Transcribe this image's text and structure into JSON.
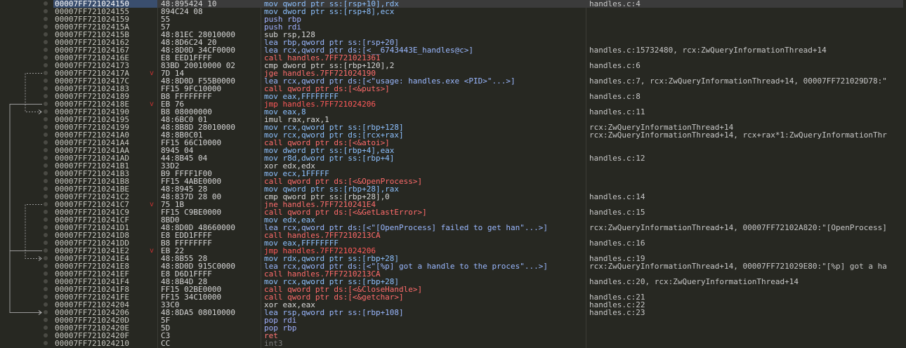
{
  "disasm": {
    "rows": [
      {
        "addr": "00007FF721024150",
        "bytes": "48:895424 10",
        "instr": "mov qword ptr ss:[rsp+10],rdx",
        "kind": "mov",
        "mark": "",
        "comment": "handles.c:4",
        "selected": true
      },
      {
        "addr": "00007FF721024155",
        "bytes": "894C24 08",
        "instr": "mov dword ptr ss:[rsp+8],ecx",
        "kind": "mov",
        "mark": "",
        "comment": ""
      },
      {
        "addr": "00007FF721024159",
        "bytes": "55",
        "instr": "push rbp",
        "kind": "push",
        "mark": "",
        "comment": ""
      },
      {
        "addr": "00007FF72102415A",
        "bytes": "57",
        "instr": "push rdi",
        "kind": "push",
        "mark": "",
        "comment": ""
      },
      {
        "addr": "00007FF72102415B",
        "bytes": "48:81EC 28010000",
        "instr": "sub rsp,128",
        "kind": "other",
        "mark": "",
        "comment": ""
      },
      {
        "addr": "00007FF721024162",
        "bytes": "48:8D6C24 20",
        "instr": "lea rbp,qword ptr ss:[rsp+20]",
        "kind": "lea",
        "mark": "",
        "comment": ""
      },
      {
        "addr": "00007FF721024167",
        "bytes": "48:8D0D 34CF0000",
        "instr": "lea rcx,qword ptr ds:[<__6743443E_handles@c>]",
        "kind": "lea",
        "mark": "",
        "comment": "handles.c:15732480, rcx:ZwQueryInformationThread+14"
      },
      {
        "addr": "00007FF72102416E",
        "bytes": "E8 EED1FFFF",
        "instr": "call handles.7FF721021361",
        "kind": "call",
        "mark": "",
        "comment": ""
      },
      {
        "addr": "00007FF721024173",
        "bytes": "83BD 20010000 02",
        "instr": "cmp dword ptr ss:[rbp+120],2",
        "kind": "other",
        "mark": "",
        "comment": "handles.c:6"
      },
      {
        "addr": "00007FF72102417A",
        "bytes": "7D 14",
        "instr": "jge handles.7FF721024190",
        "kind": "jcc",
        "mark": "v",
        "comment": ""
      },
      {
        "addr": "00007FF72102417C",
        "bytes": "48:8D0D F55B0000",
        "instr": "lea rcx,qword ptr ds:[<\"usage: handles.exe <PID>\"...>]",
        "kind": "lea",
        "mark": "",
        "comment": "handles.c:7, rcx:ZwQueryInformationThread+14, 00007FF721029D78:\""
      },
      {
        "addr": "00007FF721024183",
        "bytes": "FF15 9FC10000",
        "instr": "call qword ptr ds:[<&puts>]",
        "kind": "call",
        "mark": "",
        "comment": ""
      },
      {
        "addr": "00007FF721024189",
        "bytes": "B8 FFFFFFFF",
        "instr": "mov eax,FFFFFFFF",
        "kind": "mov",
        "mark": "",
        "comment": "handles.c:8"
      },
      {
        "addr": "00007FF72102418E",
        "bytes": "EB 76",
        "instr": "jmp handles.7FF721024206",
        "kind": "jmp",
        "mark": "v",
        "comment": ""
      },
      {
        "addr": "00007FF721024190",
        "bytes": "B8 08000000",
        "instr": "mov eax,8",
        "kind": "mov",
        "mark": "",
        "comment": "handles.c:11"
      },
      {
        "addr": "00007FF721024195",
        "bytes": "48:6BC0 01",
        "instr": "imul rax,rax,1",
        "kind": "other",
        "mark": "",
        "comment": ""
      },
      {
        "addr": "00007FF721024199",
        "bytes": "48:8B8D 28010000",
        "instr": "mov rcx,qword ptr ss:[rbp+128]",
        "kind": "mov",
        "mark": "",
        "comment": "rcx:ZwQueryInformationThread+14"
      },
      {
        "addr": "00007FF7210241A0",
        "bytes": "48:8B0C01",
        "instr": "mov rcx,qword ptr ds:[rcx+rax]",
        "kind": "mov",
        "mark": "",
        "comment": "rcx:ZwQueryInformationThread+14, rcx+rax*1:ZwQueryInformationThr"
      },
      {
        "addr": "00007FF7210241A4",
        "bytes": "FF15 66C10000",
        "instr": "call qword ptr ds:[<&atoi>]",
        "kind": "call",
        "mark": "",
        "comment": ""
      },
      {
        "addr": "00007FF7210241AA",
        "bytes": "8945 04",
        "instr": "mov dword ptr ss:[rbp+4],eax",
        "kind": "mov",
        "mark": "",
        "comment": ""
      },
      {
        "addr": "00007FF7210241AD",
        "bytes": "44:8B45 04",
        "instr": "mov r8d,dword ptr ss:[rbp+4]",
        "kind": "mov",
        "mark": "",
        "comment": "handles.c:12"
      },
      {
        "addr": "00007FF7210241B1",
        "bytes": "33D2",
        "instr": "xor edx,edx",
        "kind": "other",
        "mark": "",
        "comment": ""
      },
      {
        "addr": "00007FF7210241B3",
        "bytes": "B9 FFFF1F00",
        "instr": "mov ecx,1FFFFF",
        "kind": "mov",
        "mark": "",
        "comment": ""
      },
      {
        "addr": "00007FF7210241B8",
        "bytes": "FF15 4ABE0000",
        "instr": "call qword ptr ds:[<&OpenProcess>]",
        "kind": "call",
        "mark": "",
        "comment": ""
      },
      {
        "addr": "00007FF7210241BE",
        "bytes": "48:8945 28",
        "instr": "mov qword ptr ss:[rbp+28],rax",
        "kind": "mov",
        "mark": "",
        "comment": ""
      },
      {
        "addr": "00007FF7210241C2",
        "bytes": "48:837D 28 00",
        "instr": "cmp qword ptr ss:[rbp+28],0",
        "kind": "other",
        "mark": "",
        "comment": "handles.c:14"
      },
      {
        "addr": "00007FF7210241C7",
        "bytes": "75 1B",
        "instr": "jne handles.7FF7210241E4",
        "kind": "jcc",
        "mark": "v",
        "comment": ""
      },
      {
        "addr": "00007FF7210241C9",
        "bytes": "FF15 C9BE0000",
        "instr": "call qword ptr ds:[<&GetLastError>]",
        "kind": "call",
        "mark": "",
        "comment": "handles.c:15"
      },
      {
        "addr": "00007FF7210241CF",
        "bytes": "8BD0",
        "instr": "mov edx,eax",
        "kind": "mov",
        "mark": "",
        "comment": ""
      },
      {
        "addr": "00007FF7210241D1",
        "bytes": "48:8D0D 48660000",
        "instr": "lea rcx,qword ptr ds:[<\"[OpenProcess] failed to get han\"...>]",
        "kind": "lea",
        "mark": "",
        "comment": "rcx:ZwQueryInformationThread+14, 00007FF72102A820:\"[OpenProcess]"
      },
      {
        "addr": "00007FF7210241D8",
        "bytes": "E8 EDD1FFFF",
        "instr": "call handles.7FF7210213CA",
        "kind": "call",
        "mark": "",
        "comment": ""
      },
      {
        "addr": "00007FF7210241DD",
        "bytes": "B8 FFFFFFFF",
        "instr": "mov eax,FFFFFFFF",
        "kind": "mov",
        "mark": "",
        "comment": "handles.c:16"
      },
      {
        "addr": "00007FF7210241E2",
        "bytes": "EB 22",
        "instr": "jmp handles.7FF721024206",
        "kind": "jmp",
        "mark": "v",
        "comment": ""
      },
      {
        "addr": "00007FF7210241E4",
        "bytes": "48:8B55 28",
        "instr": "mov rdx,qword ptr ss:[rbp+28]",
        "kind": "mov",
        "mark": "",
        "comment": "handles.c:19"
      },
      {
        "addr": "00007FF7210241E8",
        "bytes": "48:8D0D 915C0000",
        "instr": "lea rcx,qword ptr ds:[<\"[%p] got a handle to the proces\"...>]",
        "kind": "lea",
        "mark": "",
        "comment": "rcx:ZwQueryInformationThread+14, 00007FF721029E80:\"[%p] got a ha"
      },
      {
        "addr": "00007FF7210241EF",
        "bytes": "E8 D6D1FFFF",
        "instr": "call handles.7FF7210213CA",
        "kind": "call",
        "mark": "",
        "comment": ""
      },
      {
        "addr": "00007FF7210241F4",
        "bytes": "48:8B4D 28",
        "instr": "mov rcx,qword ptr ss:[rbp+28]",
        "kind": "mov",
        "mark": "",
        "comment": "handles.c:20, rcx:ZwQueryInformationThread+14"
      },
      {
        "addr": "00007FF7210241F8",
        "bytes": "FF15 02BE0000",
        "instr": "call qword ptr ds:[<&CloseHandle>]",
        "kind": "call",
        "mark": "",
        "comment": ""
      },
      {
        "addr": "00007FF7210241FE",
        "bytes": "FF15 34C10000",
        "instr": "call qword ptr ds:[<&getchar>]",
        "kind": "call",
        "mark": "",
        "comment": "handles.c:21"
      },
      {
        "addr": "00007FF721024204",
        "bytes": "33C0",
        "instr": "xor eax,eax",
        "kind": "other",
        "mark": "",
        "comment": "handles.c:22"
      },
      {
        "addr": "00007FF721024206",
        "bytes": "48:8DA5 08010000",
        "instr": "lea rsp,qword ptr ss:[rbp+108]",
        "kind": "lea",
        "mark": "",
        "comment": "handles.c:23"
      },
      {
        "addr": "00007FF72102420D",
        "bytes": "5F",
        "instr": "pop rdi",
        "kind": "push",
        "mark": "",
        "comment": ""
      },
      {
        "addr": "00007FF72102420E",
        "bytes": "5D",
        "instr": "pop rbp",
        "kind": "push",
        "mark": "",
        "comment": ""
      },
      {
        "addr": "00007FF72102420F",
        "bytes": "C3",
        "instr": "ret",
        "kind": "ret",
        "mark": "",
        "comment": ""
      },
      {
        "addr": "00007FF721024210",
        "bytes": "CC",
        "instr": "int3",
        "kind": "int3",
        "mark": "",
        "comment": ""
      }
    ],
    "jumps": [
      {
        "from": 9,
        "to": 14,
        "style": "dashed"
      },
      {
        "from": 13,
        "to": 40,
        "style": "solid"
      },
      {
        "from": 26,
        "to": 33,
        "style": "dashed"
      },
      {
        "from": 32,
        "to": 40,
        "style": "solid"
      }
    ]
  }
}
